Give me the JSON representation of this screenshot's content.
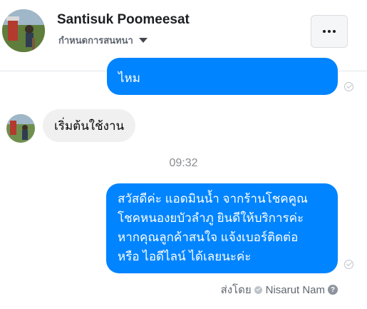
{
  "header": {
    "contact_name": "Santisuk Poomeesat",
    "conversation_setting": "กำหนดการสนทนา",
    "more_icon": "more-horizontal-icon"
  },
  "thread": {
    "outgoing_partial": "ไหม",
    "incoming": "เริ่มต้นใช้งาน",
    "timestamp": "09:32",
    "outgoing_lines": [
      "สวัสดีค่ะ แอดมินน้ำ จากร้านโชคคูณ",
      "โชคหนองยบัวลำภู ยินดีให้บริการค่ะ",
      "หากคุณลูกค้าสนใจ แจ้งเบอร์ติดต่อ",
      "หรือ ไอดีไลน์ ได้เลยนะค่ะ"
    ],
    "sent_by_label": "ส่งโดย",
    "sent_by_name": "Nisarut Nam",
    "help_glyph": "?"
  },
  "colors": {
    "outgoing_bubble": "#0084ff",
    "incoming_bubble": "#f1f0f0",
    "muted_text": "#8a8d91"
  }
}
